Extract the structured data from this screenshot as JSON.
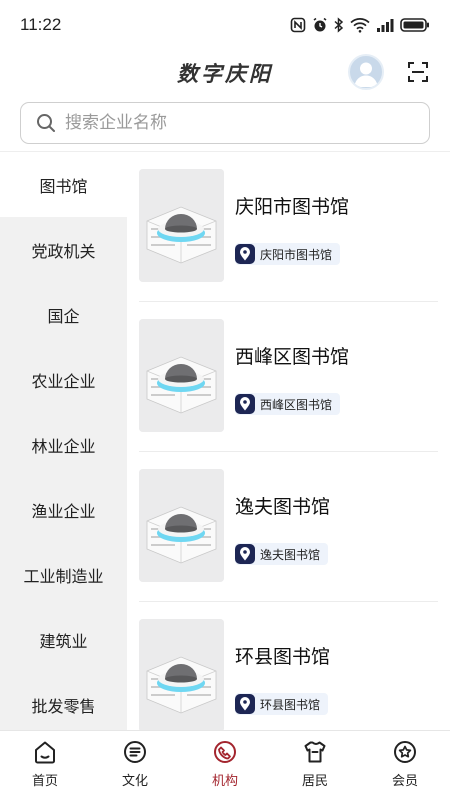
{
  "status_bar": {
    "time": "11:22"
  },
  "header": {
    "title": "数字庆阳"
  },
  "search": {
    "placeholder": "搜索企业名称"
  },
  "sidebar": {
    "items": [
      {
        "label": "图书馆",
        "active": true
      },
      {
        "label": "党政机关"
      },
      {
        "label": "国企"
      },
      {
        "label": "农业企业"
      },
      {
        "label": "林业企业"
      },
      {
        "label": "渔业企业"
      },
      {
        "label": "工业制造业"
      },
      {
        "label": "建筑业"
      },
      {
        "label": "批发零售"
      }
    ]
  },
  "list": {
    "items": [
      {
        "name": "庆阳市图书馆",
        "tag": "庆阳市图书馆"
      },
      {
        "name": "西峰区图书馆",
        "tag": "西峰区图书馆"
      },
      {
        "name": "逸夫图书馆",
        "tag": "逸夫图书馆"
      },
      {
        "name": "环县图书馆",
        "tag": "环县图书馆"
      }
    ]
  },
  "tabbar": {
    "items": [
      {
        "label": "首页",
        "icon": "home-icon"
      },
      {
        "label": "文化",
        "icon": "culture-icon"
      },
      {
        "label": "机构",
        "icon": "organization-icon",
        "active": true
      },
      {
        "label": "居民",
        "icon": "resident-icon"
      },
      {
        "label": "会员",
        "icon": "member-icon"
      }
    ]
  },
  "colors": {
    "accent": "#a3252e",
    "tag_badge": "#1d2654",
    "tag_bg": "#eef3fb",
    "sidebar_bg": "#f1f1f1"
  }
}
